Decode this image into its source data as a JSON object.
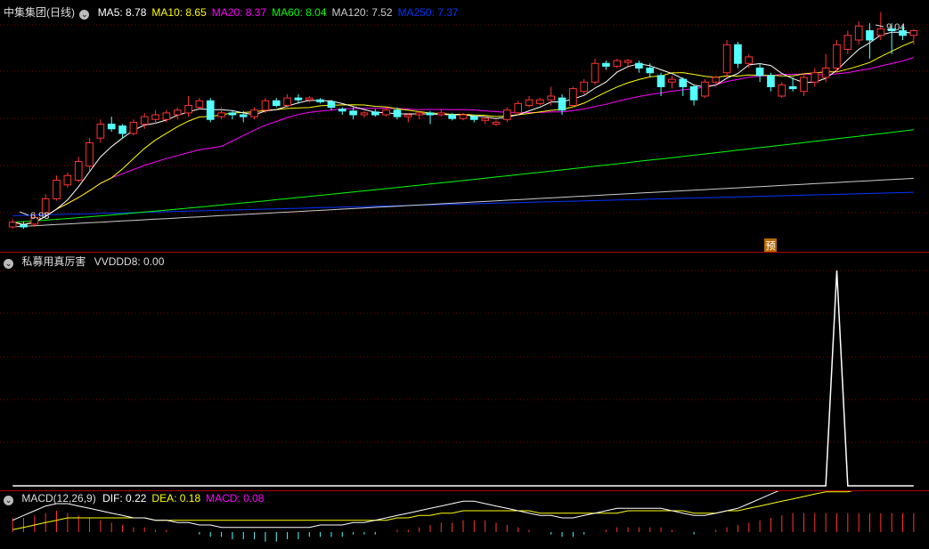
{
  "price_panel": {
    "title": "中集集团(日线)",
    "indicators": [
      {
        "label": "MA5: 8.78",
        "color": "#ffffff"
      },
      {
        "label": "MA10: 8.65",
        "color": "#ffff00"
      },
      {
        "label": "MA20: 8.37",
        "color": "#ff00ff"
      },
      {
        "label": "MA60: 8.04",
        "color": "#00ff00"
      },
      {
        "label": "MA120: 7.52",
        "color": "#cccccc"
      },
      {
        "label": "MA250: 7.37",
        "color": "#0033ff"
      }
    ],
    "high_label": "9.04",
    "low_label": "6.98",
    "forecast_badge": "预"
  },
  "indicator_panel": {
    "title": "私募用真厉害",
    "series_label": "VVDDD8: 0.00"
  },
  "macd_panel": {
    "title": "MACD(12,26,9)",
    "values": [
      {
        "label": "DIF: 0.22",
        "color": "#ffffff"
      },
      {
        "label": "DEA: 0.18",
        "color": "#ffff00"
      },
      {
        "label": "MACD: 0.08",
        "color": "#ff00ff"
      }
    ]
  },
  "colors": {
    "up": "#ff3333",
    "down": "#54ffff",
    "grid": "#7a0000",
    "separator": "#b00000"
  },
  "chart_data": [
    {
      "type": "candlestick",
      "title": "中集集团(日线)",
      "ylim": [
        6.8,
        9.2
      ],
      "candles": [
        [
          7.0,
          7.05,
          6.98,
          7.08
        ],
        [
          7.02,
          7.0,
          6.98,
          7.06
        ],
        [
          7.03,
          7.1,
          7.0,
          7.15
        ],
        [
          7.15,
          7.3,
          7.12,
          7.35
        ],
        [
          7.3,
          7.5,
          7.28,
          7.55
        ],
        [
          7.45,
          7.55,
          7.42,
          7.58
        ],
        [
          7.5,
          7.7,
          7.48,
          7.75
        ],
        [
          7.65,
          7.9,
          7.6,
          7.95
        ],
        [
          7.95,
          8.1,
          7.9,
          8.15
        ],
        [
          8.1,
          8.05,
          8.02,
          8.18
        ],
        [
          8.08,
          8.0,
          7.95,
          8.1
        ],
        [
          8.0,
          8.12,
          7.98,
          8.15
        ],
        [
          8.1,
          8.18,
          8.05,
          8.22
        ],
        [
          8.15,
          8.2,
          8.1,
          8.25
        ],
        [
          8.15,
          8.22,
          8.12,
          8.25
        ],
        [
          8.2,
          8.25,
          8.15,
          8.28
        ],
        [
          8.22,
          8.3,
          8.18,
          8.4
        ],
        [
          8.28,
          8.35,
          8.25,
          8.38
        ],
        [
          8.35,
          8.15,
          8.12,
          8.38
        ],
        [
          8.18,
          8.22,
          8.15,
          8.28
        ],
        [
          8.22,
          8.2,
          8.15,
          8.25
        ],
        [
          8.2,
          8.18,
          8.12,
          8.24
        ],
        [
          8.18,
          8.25,
          8.15,
          8.28
        ],
        [
          8.25,
          8.35,
          8.22,
          8.38
        ],
        [
          8.35,
          8.3,
          8.28,
          8.38
        ],
        [
          8.3,
          8.38,
          8.28,
          8.42
        ],
        [
          8.38,
          8.36,
          8.32,
          8.42
        ],
        [
          8.36,
          8.38,
          8.33,
          8.4
        ],
        [
          8.36,
          8.34,
          8.32,
          8.38
        ],
        [
          8.34,
          8.28,
          8.25,
          8.36
        ],
        [
          8.26,
          8.24,
          8.2,
          8.28
        ],
        [
          8.24,
          8.2,
          8.15,
          8.28
        ],
        [
          8.2,
          8.22,
          8.17,
          8.24
        ],
        [
          8.23,
          8.2,
          8.18,
          8.26
        ],
        [
          8.2,
          8.25,
          8.18,
          8.28
        ],
        [
          8.25,
          8.18,
          8.15,
          8.28
        ],
        [
          8.18,
          8.2,
          8.12,
          8.22
        ],
        [
          8.2,
          8.22,
          8.15,
          8.24
        ],
        [
          8.22,
          8.2,
          8.1,
          8.24
        ],
        [
          8.2,
          8.22,
          8.18,
          8.26
        ],
        [
          8.2,
          8.16,
          8.14,
          8.22
        ],
        [
          8.16,
          8.2,
          8.14,
          8.22
        ],
        [
          8.18,
          8.15,
          8.12,
          8.2
        ],
        [
          8.14,
          8.16,
          8.1,
          8.18
        ],
        [
          8.1,
          8.12,
          8.08,
          8.14
        ],
        [
          8.15,
          8.25,
          8.12,
          8.28
        ],
        [
          8.22,
          8.32,
          8.2,
          8.35
        ],
        [
          8.3,
          8.36,
          8.28,
          8.4
        ],
        [
          8.32,
          8.36,
          8.3,
          8.38
        ],
        [
          8.36,
          8.4,
          8.3,
          8.5
        ],
        [
          8.38,
          8.25,
          8.2,
          8.42
        ],
        [
          8.3,
          8.48,
          8.28,
          8.5
        ],
        [
          8.45,
          8.55,
          8.42,
          8.58
        ],
        [
          8.55,
          8.75,
          8.52,
          8.8
        ],
        [
          8.75,
          8.72,
          8.68,
          8.78
        ],
        [
          8.72,
          8.78,
          8.7,
          8.8
        ],
        [
          8.76,
          8.78,
          8.72,
          8.8
        ],
        [
          8.75,
          8.7,
          8.65,
          8.78
        ],
        [
          8.7,
          8.65,
          8.6,
          8.75
        ],
        [
          8.62,
          8.5,
          8.4,
          8.65
        ],
        [
          8.55,
          8.58,
          8.48,
          8.62
        ],
        [
          8.58,
          8.5,
          8.4,
          8.6
        ],
        [
          8.5,
          8.36,
          8.3,
          8.52
        ],
        [
          8.4,
          8.55,
          8.38,
          8.58
        ],
        [
          8.55,
          8.6,
          8.5,
          8.62
        ],
        [
          8.65,
          8.95,
          8.6,
          9.0
        ],
        [
          8.95,
          8.75,
          8.7,
          8.98
        ],
        [
          8.75,
          8.82,
          8.7,
          8.85
        ],
        [
          8.7,
          8.62,
          8.55,
          8.75
        ],
        [
          8.62,
          8.5,
          8.45,
          8.65
        ],
        [
          8.4,
          8.52,
          8.38,
          8.55
        ],
        [
          8.5,
          8.48,
          8.45,
          8.6
        ],
        [
          8.45,
          8.6,
          8.4,
          8.65
        ],
        [
          8.55,
          8.65,
          8.5,
          8.7
        ],
        [
          8.6,
          8.7,
          8.55,
          8.85
        ],
        [
          8.7,
          8.95,
          8.65,
          9.0
        ],
        [
          8.9,
          9.05,
          8.85,
          9.1
        ],
        [
          9.0,
          9.15,
          8.95,
          9.2
        ],
        [
          9.1,
          9.0,
          8.8,
          9.18
        ],
        [
          9.05,
          9.12,
          9.0,
          9.3
        ],
        [
          9.12,
          9.1,
          8.85,
          9.18
        ],
        [
          9.1,
          9.05,
          9.0,
          9.15
        ],
        [
          9.05,
          9.1,
          8.95,
          9.12
        ]
      ]
    },
    {
      "type": "line",
      "title": "私募用真厉害",
      "name": "VVDDD8",
      "ylim": [
        0,
        1
      ],
      "values": [
        0,
        0,
        0,
        0,
        0,
        0,
        0,
        0,
        0,
        0,
        0,
        0,
        0,
        0,
        0,
        0,
        0,
        0,
        0,
        0,
        0,
        0,
        0,
        0,
        0,
        0,
        0,
        0,
        0,
        0,
        0,
        0,
        0,
        0,
        0,
        0,
        0,
        0,
        0,
        0,
        0,
        0,
        0,
        0,
        0,
        0,
        0,
        0,
        0,
        0,
        0,
        0,
        0,
        0,
        0,
        0,
        0,
        0,
        0,
        0,
        0,
        0,
        0,
        0,
        0,
        0,
        0,
        0,
        0,
        0,
        0,
        0,
        0,
        0,
        0,
        1,
        0,
        0,
        0,
        0,
        0,
        0,
        0
      ]
    },
    {
      "type": "bar",
      "title": "MACD(12,26,9)",
      "ylim": [
        -0.06,
        0.12
      ],
      "macd": [
        0.06,
        0.06,
        0.07,
        0.08,
        0.09,
        0.08,
        0.07,
        0.06,
        0.05,
        0.04,
        0.03,
        0.02,
        0.02,
        0.01,
        0.01,
        0.0,
        0.0,
        -0.01,
        -0.02,
        -0.02,
        -0.03,
        -0.03,
        -0.03,
        -0.04,
        -0.04,
        -0.03,
        -0.03,
        -0.02,
        -0.02,
        -0.02,
        -0.02,
        -0.01,
        -0.01,
        -0.01,
        0.0,
        0.01,
        0.01,
        0.02,
        0.03,
        0.04,
        0.04,
        0.05,
        0.05,
        0.05,
        0.04,
        0.03,
        0.02,
        0.01,
        0.0,
        -0.01,
        -0.02,
        -0.02,
        -0.01,
        0.0,
        0.01,
        0.02,
        0.02,
        0.02,
        0.02,
        0.02,
        0.01,
        0.0,
        -0.01,
        0.0,
        0.01,
        0.02,
        0.03,
        0.04,
        0.05,
        0.06,
        0.07,
        0.08,
        0.08,
        0.08,
        0.08,
        0.08,
        0.08,
        0.08,
        0.08,
        0.08,
        0.08,
        0.08,
        0.08
      ],
      "dif": [
        0.05,
        0.07,
        0.09,
        0.11,
        0.12,
        0.12,
        0.11,
        0.1,
        0.09,
        0.08,
        0.07,
        0.06,
        0.06,
        0.05,
        0.05,
        0.04,
        0.04,
        0.03,
        0.03,
        0.02,
        0.02,
        0.02,
        0.02,
        0.02,
        0.02,
        0.02,
        0.02,
        0.02,
        0.03,
        0.03,
        0.03,
        0.04,
        0.04,
        0.05,
        0.06,
        0.07,
        0.08,
        0.09,
        0.1,
        0.11,
        0.12,
        0.13,
        0.13,
        0.12,
        0.11,
        0.1,
        0.09,
        0.08,
        0.07,
        0.07,
        0.06,
        0.06,
        0.07,
        0.08,
        0.09,
        0.1,
        0.1,
        0.1,
        0.1,
        0.1,
        0.09,
        0.08,
        0.07,
        0.07,
        0.08,
        0.09,
        0.1,
        0.12,
        0.14,
        0.16,
        0.18,
        0.19,
        0.2,
        0.2,
        0.21,
        0.21,
        0.21,
        0.22,
        0.22,
        0.22,
        0.22,
        0.22,
        0.22
      ],
      "dea": [
        0.01,
        0.02,
        0.03,
        0.04,
        0.05,
        0.06,
        0.06,
        0.06,
        0.06,
        0.06,
        0.06,
        0.06,
        0.06,
        0.05,
        0.05,
        0.05,
        0.05,
        0.05,
        0.05,
        0.05,
        0.05,
        0.05,
        0.05,
        0.05,
        0.05,
        0.05,
        0.05,
        0.05,
        0.05,
        0.05,
        0.05,
        0.05,
        0.05,
        0.05,
        0.05,
        0.06,
        0.06,
        0.07,
        0.07,
        0.08,
        0.08,
        0.09,
        0.09,
        0.09,
        0.09,
        0.09,
        0.09,
        0.09,
        0.08,
        0.08,
        0.08,
        0.08,
        0.08,
        0.08,
        0.08,
        0.08,
        0.09,
        0.09,
        0.09,
        0.09,
        0.09,
        0.09,
        0.08,
        0.08,
        0.08,
        0.09,
        0.09,
        0.1,
        0.11,
        0.12,
        0.13,
        0.14,
        0.15,
        0.16,
        0.17,
        0.17,
        0.17,
        0.18,
        0.18,
        0.18,
        0.18,
        0.18,
        0.18
      ]
    }
  ]
}
